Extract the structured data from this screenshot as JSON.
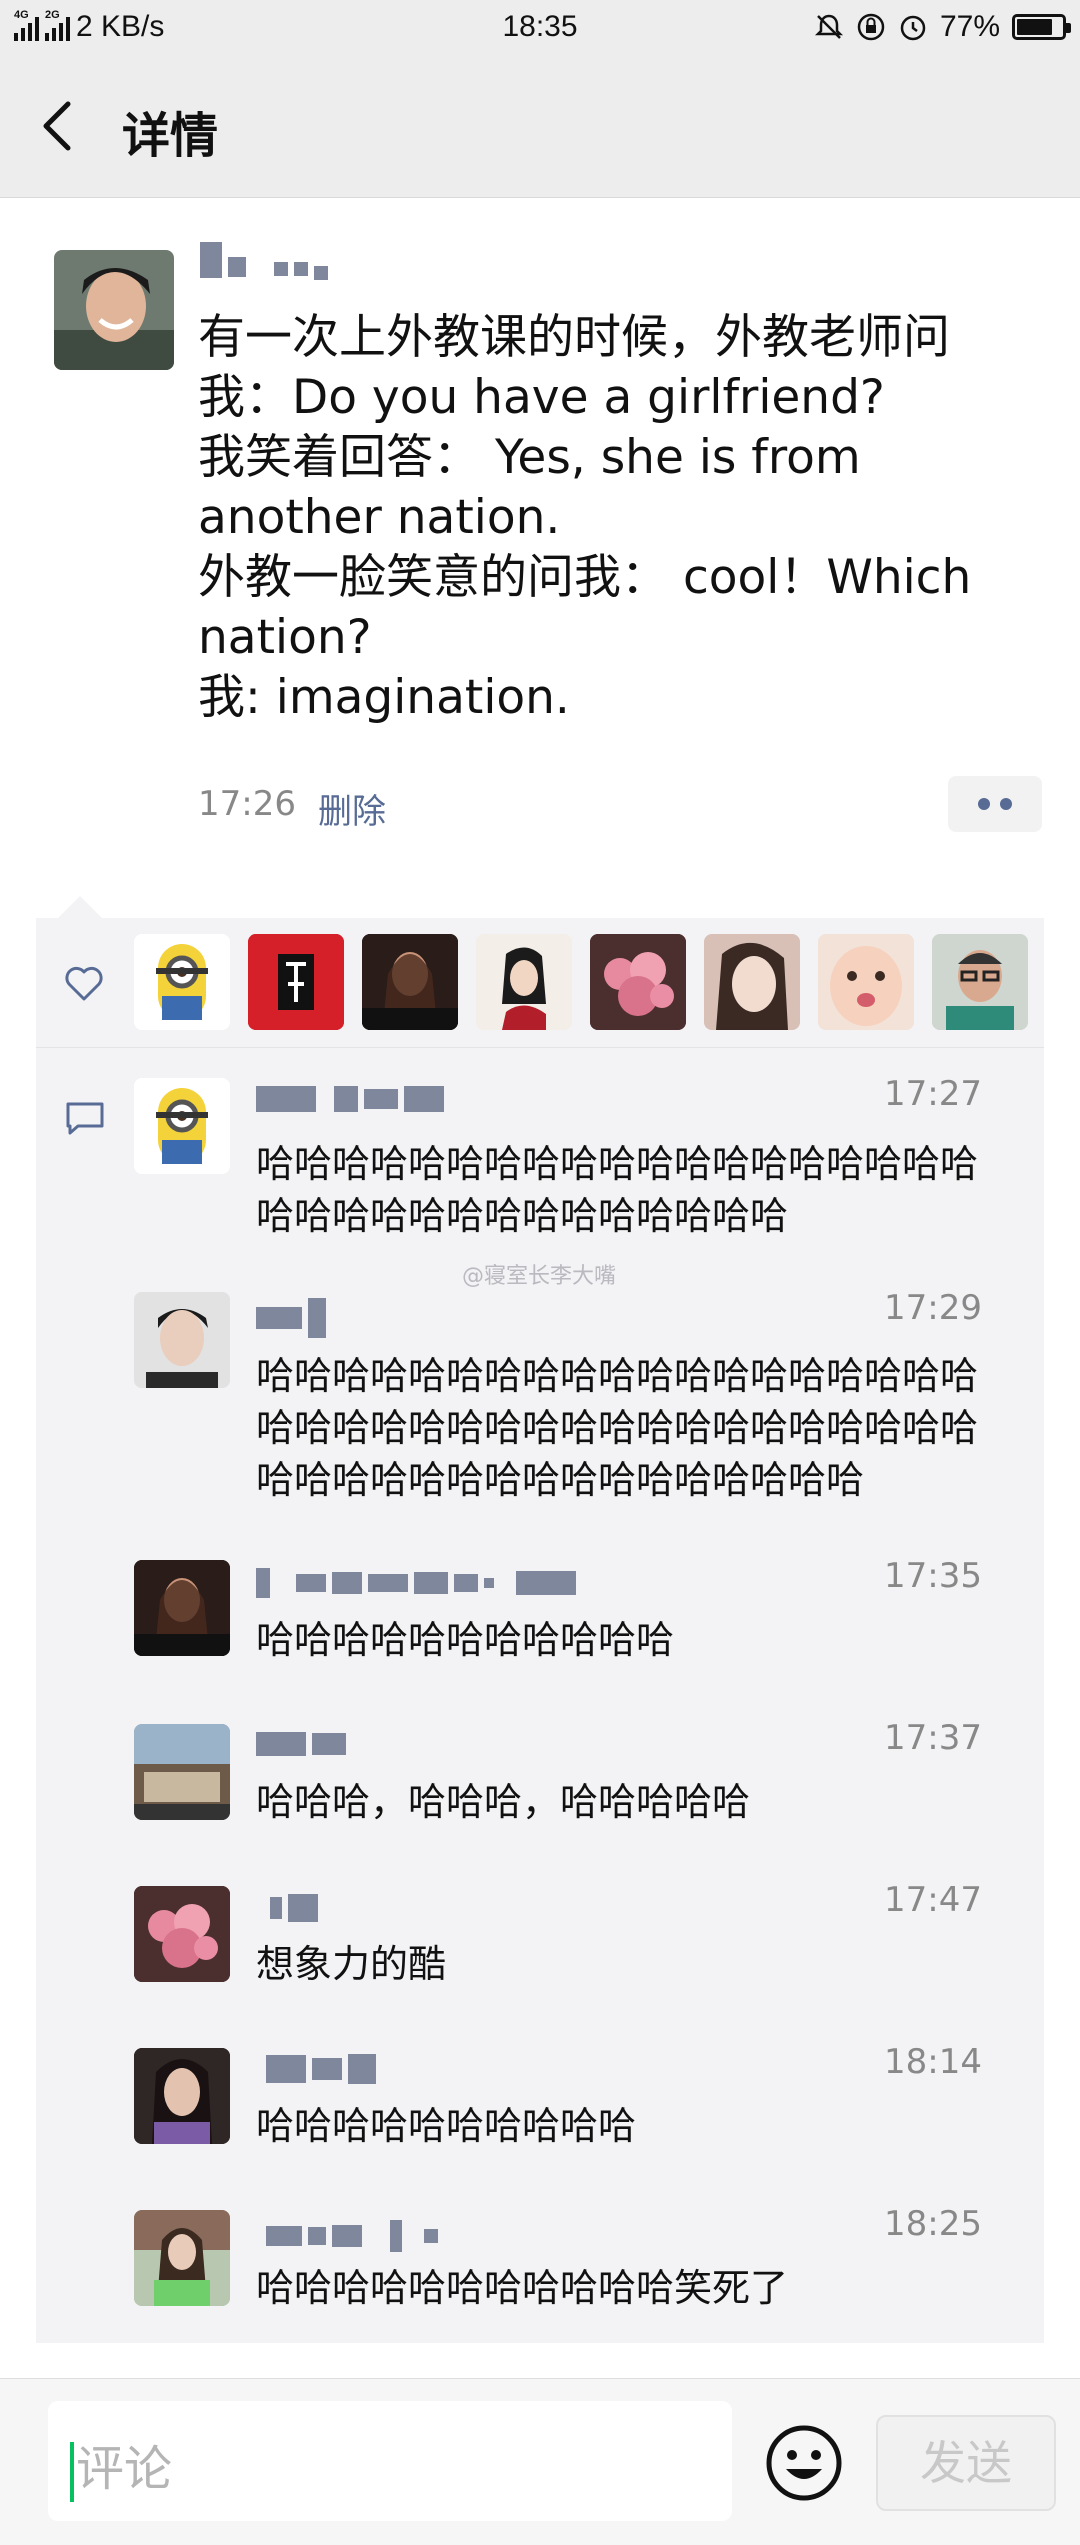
{
  "status_bar": {
    "net_top": "4G",
    "net_bottom": "2G",
    "speed": "2 KB/s",
    "time": "18:35",
    "battery": "77%",
    "battery_level": 0.77
  },
  "header": {
    "title": "详情",
    "back_icon": "chevron-left-icon"
  },
  "post": {
    "text": "有一次上外教课的时候，外教老师问\n我：Do you have a girlfriend?\n我笑着回答： Yes, she is from\nanother nation.\n外教一脸笑意的问我： cool！Which\nnation?\n我: imagination.",
    "time": "17:26",
    "delete_label": "删除"
  },
  "likes": {
    "icon": "heart-icon",
    "count_avatars": 8
  },
  "comments": [
    {
      "time": "17:27",
      "text": "哈哈哈哈哈哈哈哈哈哈哈哈哈哈哈哈哈哈哈哈哈哈哈哈哈哈哈哈哈哈哈哈哈"
    },
    {
      "time": "17:29",
      "text": "哈哈哈哈哈哈哈哈哈哈哈哈哈哈哈哈哈哈哈哈哈哈哈哈哈哈哈哈哈哈哈哈哈哈哈哈哈哈哈哈哈哈哈哈哈哈哈哈哈哈哈哈哈哈"
    },
    {
      "time": "17:35",
      "text": "哈哈哈哈哈哈哈哈哈哈哈"
    },
    {
      "time": "17:37",
      "text": "哈哈哈，哈哈哈，哈哈哈哈哈"
    },
    {
      "time": "17:47",
      "text": "想象力的酷"
    },
    {
      "time": "18:14",
      "text": "哈哈哈哈哈哈哈哈哈哈"
    },
    {
      "time": "18:25",
      "text": "哈哈哈哈哈哈哈哈哈哈哈笑死了"
    }
  ],
  "watermark": "@寝室长李大嘴",
  "footer": {
    "input_placeholder": "评论",
    "emoji_icon": "smiley-icon",
    "send_label": "发送"
  }
}
